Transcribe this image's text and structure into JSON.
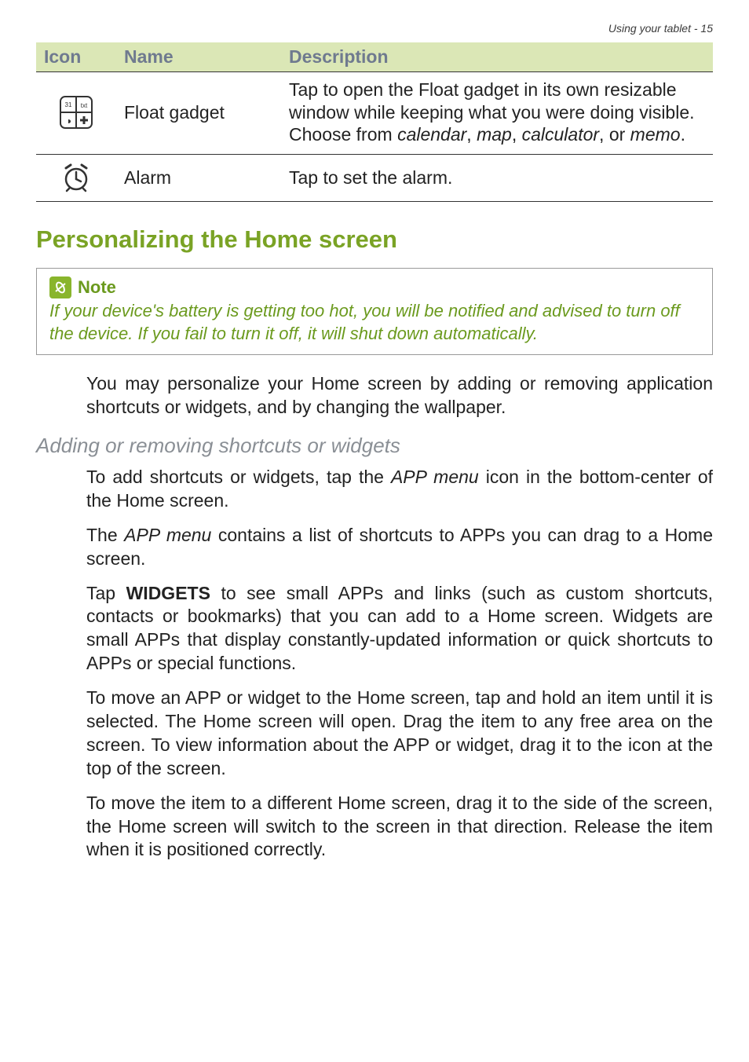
{
  "running_head": "Using your tablet - 15",
  "table": {
    "headers": {
      "icon": "Icon",
      "name": "Name",
      "desc": "Description"
    },
    "rows": [
      {
        "icon_name": "float-gadget-icon",
        "name": "Float gadget",
        "desc_pre": "Tap to open the Float gadget in its own resizable window while keeping what you were doing visible. Choose from ",
        "desc_i1": "calendar",
        "desc_c1": ", ",
        "desc_i2": "map",
        "desc_c2": ", ",
        "desc_i3": "calculator",
        "desc_c3": ", or ",
        "desc_i4": "memo",
        "desc_post": "."
      },
      {
        "icon_name": "alarm-icon",
        "name": "Alarm",
        "desc_pre": "Tap to set the alarm.",
        "desc_i1": "",
        "desc_c1": "",
        "desc_i2": "",
        "desc_c2": "",
        "desc_i3": "",
        "desc_c3": "",
        "desc_i4": "",
        "desc_post": ""
      }
    ]
  },
  "section_heading": "Personalizing the Home screen",
  "note": {
    "title": "Note",
    "body": "If your device's battery is getting too hot, you will be notified and advised to turn off the device. If you fail to turn it off, it will shut down automatically."
  },
  "para1": "You may personalize your Home screen by adding or removing application shortcuts or widgets, and by changing the wallpaper.",
  "subhead": "Adding or removing shortcuts or widgets",
  "para2_pre": "To add shortcuts or widgets, tap the ",
  "para2_i": "APP menu",
  "para2_post": " icon in the bottom-center of the Home screen.",
  "para3_pre": "The ",
  "para3_i": "APP menu",
  "para3_post": " contains a list of shortcuts to APPs you can drag to a Home screen.",
  "para4_pre": "Tap ",
  "para4_b": "WIDGETS",
  "para4_post": " to see small APPs and links (such as custom shortcuts, contacts or bookmarks) that you can add to a Home screen. Widgets are small APPs that display constantly-updated information or quick shortcuts to APPs or special functions.",
  "para5": "To move an APP or widget to the Home screen, tap and hold an item until it is selected. The Home screen will open. Drag the item to any free area on the screen. To view information about the APP or widget, drag it to the icon at the top of the screen.",
  "para6": "To move the item to a different Home screen, drag it to the side of the screen, the Home screen will switch to the screen in that direction. Release the item when it is positioned correctly."
}
